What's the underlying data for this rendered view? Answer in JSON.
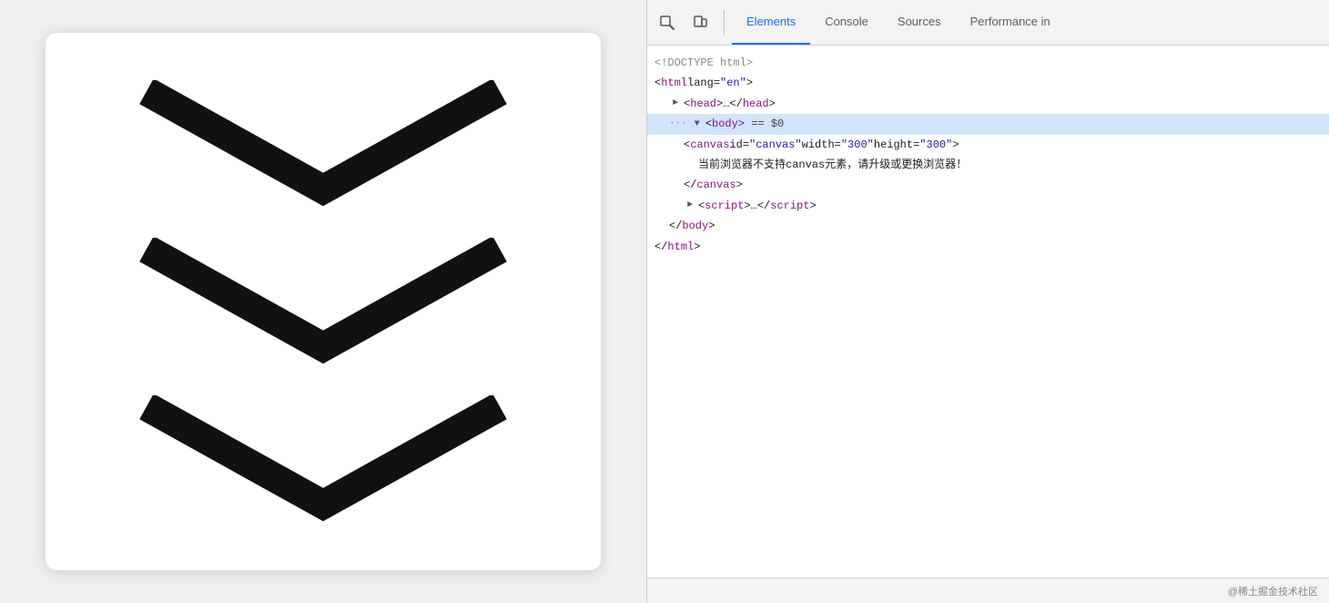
{
  "leftPanel": {
    "label": "canvas-preview"
  },
  "devtools": {
    "tabs": [
      {
        "id": "elements",
        "label": "Elements",
        "active": true
      },
      {
        "id": "console",
        "label": "Console",
        "active": false
      },
      {
        "id": "sources",
        "label": "Sources",
        "active": false
      },
      {
        "id": "performance",
        "label": "Performance in",
        "active": false
      }
    ],
    "domLines": [
      {
        "indent": 0,
        "toggle": null,
        "ellipsis": null,
        "parts": [
          {
            "text": "<!DOCTYPE html>",
            "class": "c-gray"
          }
        ]
      },
      {
        "indent": 0,
        "toggle": null,
        "ellipsis": null,
        "parts": [
          {
            "text": "<",
            "class": "c-black"
          },
          {
            "text": "html",
            "class": "c-purple"
          },
          {
            "text": " lang=",
            "class": "c-black"
          },
          {
            "text": "\"en\"",
            "class": "c-blue"
          },
          {
            "text": ">",
            "class": "c-black"
          }
        ]
      },
      {
        "indent": 1,
        "toggle": "►",
        "ellipsis": null,
        "parts": [
          {
            "text": "<",
            "class": "c-black"
          },
          {
            "text": "head",
            "class": "c-purple"
          },
          {
            "text": ">…</",
            "class": "c-black"
          },
          {
            "text": "head",
            "class": "c-purple"
          },
          {
            "text": ">",
            "class": "c-black"
          }
        ]
      },
      {
        "indent": 1,
        "selected": true,
        "toggle": "▼",
        "ellipsis": "···",
        "parts": [
          {
            "text": "<",
            "class": "c-black"
          },
          {
            "text": "body",
            "class": "c-purple"
          },
          {
            "text": "> == $0",
            "class": "c-eq"
          }
        ]
      },
      {
        "indent": 2,
        "toggle": null,
        "ellipsis": null,
        "parts": [
          {
            "text": "<",
            "class": "c-black"
          },
          {
            "text": "canvas",
            "class": "c-purple"
          },
          {
            "text": " id=",
            "class": "c-black"
          },
          {
            "text": "\"canvas\"",
            "class": "c-blue"
          },
          {
            "text": " width=",
            "class": "c-black"
          },
          {
            "text": "\"300\"",
            "class": "c-blue"
          },
          {
            "text": " height=",
            "class": "c-black"
          },
          {
            "text": "\"300\"",
            "class": "c-blue"
          },
          {
            "text": ">",
            "class": "c-black"
          }
        ]
      },
      {
        "indent": 3,
        "toggle": null,
        "ellipsis": null,
        "parts": [
          {
            "text": "当前浏览器不支持canvas元素，请升级或更换浏览器！",
            "class": "c-black"
          }
        ]
      },
      {
        "indent": 2,
        "toggle": null,
        "ellipsis": null,
        "parts": [
          {
            "text": "</",
            "class": "c-black"
          },
          {
            "text": "canvas",
            "class": "c-purple"
          },
          {
            "text": ">",
            "class": "c-black"
          }
        ]
      },
      {
        "indent": 2,
        "toggle": "►",
        "ellipsis": null,
        "parts": [
          {
            "text": "<",
            "class": "c-black"
          },
          {
            "text": "script",
            "class": "c-purple"
          },
          {
            "text": ">…</",
            "class": "c-black"
          },
          {
            "text": "script",
            "class": "c-purple"
          },
          {
            "text": ">",
            "class": "c-black"
          }
        ]
      },
      {
        "indent": 1,
        "toggle": null,
        "ellipsis": null,
        "parts": [
          {
            "text": "</",
            "class": "c-black"
          },
          {
            "text": "body",
            "class": "c-purple"
          },
          {
            "text": ">",
            "class": "c-black"
          }
        ]
      },
      {
        "indent": 0,
        "toggle": null,
        "ellipsis": null,
        "parts": [
          {
            "text": "</",
            "class": "c-black"
          },
          {
            "text": "html",
            "class": "c-purple"
          },
          {
            "text": ">",
            "class": "c-black"
          }
        ]
      }
    ],
    "footer": {
      "watermark": "@稀土掘金技术社区"
    }
  }
}
